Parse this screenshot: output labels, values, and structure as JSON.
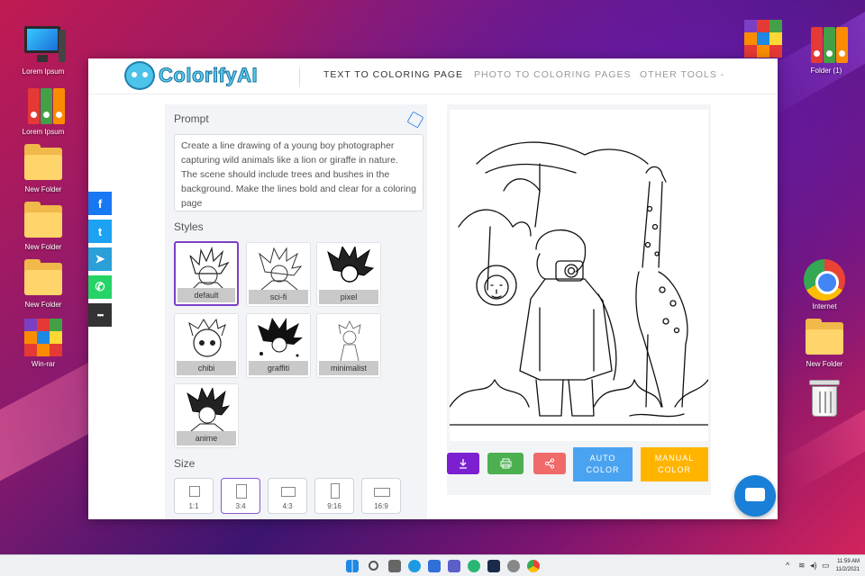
{
  "desktop": {
    "icons_left": [
      {
        "label": "Lorem Ipsum",
        "icon": "computer-icon"
      },
      {
        "label": "Lorem Ipsum",
        "icon": "binders-icon"
      },
      {
        "label": "New Folder",
        "icon": "folder-icon"
      },
      {
        "label": "New Folder",
        "icon": "folder-icon"
      },
      {
        "label": "New Folder",
        "icon": "folder-icon"
      },
      {
        "label": "Win-rar",
        "icon": "winrar-icon"
      }
    ],
    "icons_right": [
      {
        "label": "",
        "icon": "winrar-icon"
      },
      {
        "label": "Folder (1)",
        "icon": "binders-icon"
      },
      {
        "label": "Internet",
        "icon": "chrome-icon"
      },
      {
        "label": "New Folder",
        "icon": "folder-icon"
      },
      {
        "label": "",
        "icon": "recycle-bin-icon"
      }
    ]
  },
  "share": [
    {
      "name": "facebook",
      "glyph": "f",
      "color": "#1877f2"
    },
    {
      "name": "twitter",
      "glyph": "t",
      "color": "#1da1f2"
    },
    {
      "name": "telegram",
      "glyph": "➤",
      "color": "#2a9fd8"
    },
    {
      "name": "whatsapp",
      "glyph": "✆",
      "color": "#25d366"
    },
    {
      "name": "more",
      "glyph": "•••",
      "color": "#333333"
    }
  ],
  "app": {
    "logo_text": "ColorifyAI",
    "nav": [
      {
        "label": "TEXT TO COLORING PAGE",
        "active": true
      },
      {
        "label": "PHOTO TO COLORING PAGES",
        "active": false
      },
      {
        "label": "OTHER TOOLS -",
        "active": false
      }
    ],
    "prompt_label": "Prompt",
    "prompt_text": "Create a line drawing of a young boy photographer capturing wild animals like a lion or giraffe in nature. The scene should include trees and bushes in the background. Make the lines bold and clear for a coloring page",
    "styles_label": "Styles",
    "styles": [
      {
        "label": "default",
        "selected": true
      },
      {
        "label": "sci-fi",
        "selected": false
      },
      {
        "label": "pixel",
        "selected": false
      },
      {
        "label": "chibi",
        "selected": false
      },
      {
        "label": "graffiti",
        "selected": false
      },
      {
        "label": "minimalist",
        "selected": false
      },
      {
        "label": "anime",
        "selected": false
      }
    ],
    "size_label": "Size",
    "sizes": [
      {
        "label": "1:1",
        "selected": false
      },
      {
        "label": "3:4",
        "selected": true
      },
      {
        "label": "4:3",
        "selected": false
      },
      {
        "label": "9:16",
        "selected": false
      },
      {
        "label": "16:9",
        "selected": false
      }
    ],
    "actions": {
      "download_icon": "download-icon",
      "print_icon": "print-icon",
      "share_icon": "share-icon",
      "auto_color": "AUTO COLOR",
      "manual_color": "MANUAL COLOR",
      "colors": {
        "download": "#7b1fd1",
        "print": "#4caf50",
        "share": "#f06a6a",
        "auto": "#4aa3f0",
        "manual": "#ffb400"
      }
    }
  },
  "taskbar": {
    "time": "11:59 AM",
    "date": "11/2/2021"
  }
}
